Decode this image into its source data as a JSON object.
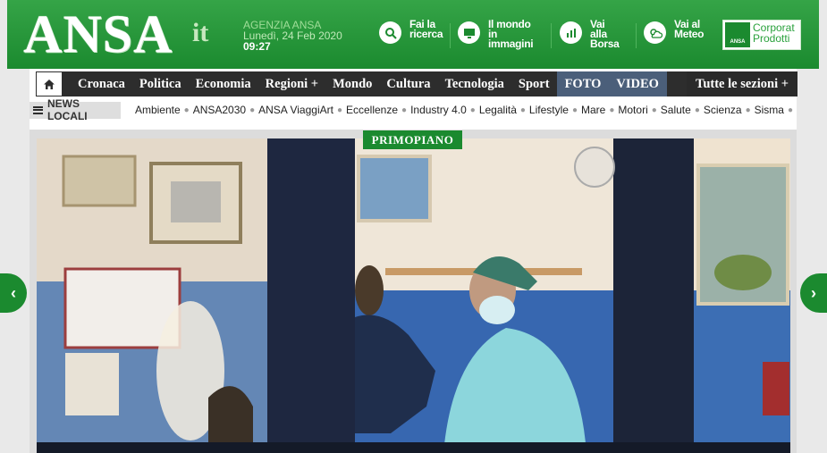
{
  "header": {
    "logo": "ANSA",
    "logo_suffix": "it",
    "agency_name": "AGENZIA ANSA",
    "date": "Lunedì, 24 Feb 2020",
    "time": "09:27",
    "links": [
      {
        "line1": "Fai la",
        "line2": "ricerca",
        "icon": "search-icon"
      },
      {
        "line1": "Il mondo",
        "line2": "in",
        "line3": "immagini",
        "icon": "monitor-icon"
      },
      {
        "line1": "Vai",
        "line2": "alla",
        "line3": "Borsa",
        "icon": "bar-chart-icon"
      },
      {
        "line1": "Vai al",
        "line2": "Meteo",
        "icon": "weather-icon"
      }
    ],
    "corporate": {
      "line1": "Corporat",
      "line2": "Prodotti",
      "mini": "ANSA"
    }
  },
  "nav": {
    "items": [
      "Cronaca",
      "Politica",
      "Economia",
      "Regioni +",
      "Mondo",
      "Cultura",
      "Tecnologia",
      "Sport"
    ],
    "media": [
      "FOTO",
      "VIDEO"
    ],
    "all_sections": "Tutte le sezioni +"
  },
  "local": {
    "label": "NEWS LOCALI",
    "topics": [
      "Ambiente",
      "ANSA2030",
      "ANSA ViaggiArt",
      "Eccellenze",
      "Industry 4.0",
      "Legalità",
      "Lifestyle",
      "Mare",
      "Motori",
      "Salute",
      "Scienza",
      "Sisma"
    ]
  },
  "hero": {
    "badge": "PRIMOPIANO"
  },
  "colors": {
    "brand_green": "#1b8a2f",
    "nav_dark": "#2d2d2d",
    "nav_media": "#4b5f7a"
  }
}
